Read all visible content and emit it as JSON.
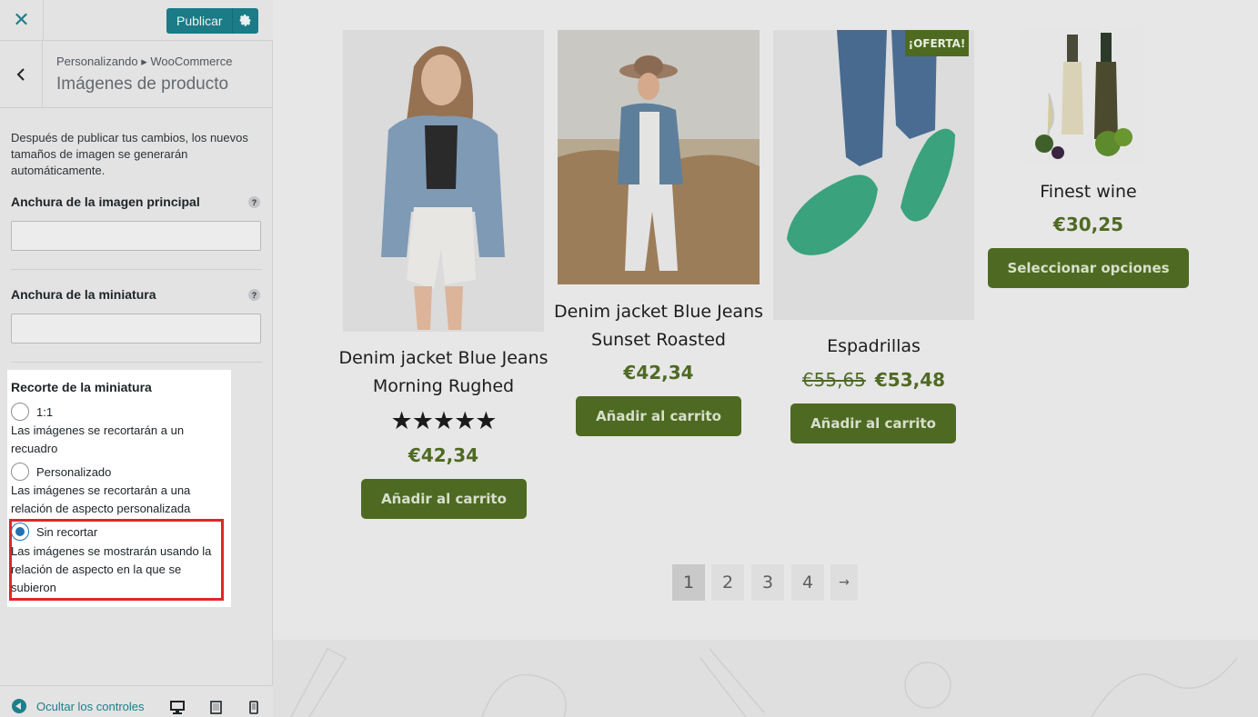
{
  "customizer": {
    "close_icon": "close-icon",
    "publish_label": "Publicar",
    "breadcrumb": "Personalizando ▸ WooCommerce",
    "section_title": "Imágenes de producto",
    "description": "Después de publicar tus cambios, los nuevos tamaños de imagen se generarán automáticamente.",
    "main_image_width_label": "Anchura de la imagen principal",
    "main_image_width_value": "",
    "thumbnail_width_label": "Anchura de la miniatura",
    "thumbnail_width_value": "",
    "help_glyph": "?",
    "crop": {
      "title": "Recorte de la miniatura",
      "options": [
        {
          "label": "1:1",
          "description": "Las imágenes se recortarán a un recuadro",
          "checked": false
        },
        {
          "label": "Personalizado",
          "description": "Las imágenes se recortarán a una relación de aspecto personalizada",
          "checked": false
        },
        {
          "label": "Sin recortar",
          "description": "Las imágenes se mostrarán usando la relación de aspecto en la que se subieron",
          "checked": true
        }
      ]
    },
    "footer": {
      "hide_controls": "Ocultar los controles",
      "devices": [
        "desktop-icon",
        "tablet-icon",
        "mobile-icon"
      ]
    }
  },
  "preview": {
    "products": [
      {
        "name": "Denim jacket Blue Jeans Morning Rughed",
        "rating_stars": "★★★★★",
        "rating": 5,
        "price": "€42,34",
        "button": "Añadir al carrito"
      },
      {
        "name": "Denim jacket Blue Jeans Sunset Roasted",
        "price": "€42,34",
        "button": "Añadir al carrito"
      },
      {
        "name": "Espadrillas",
        "badge": "¡OFERTA!",
        "old_price": "€55,65",
        "price": "€53,48",
        "button": "Añadir al carrito"
      },
      {
        "name": "Finest wine",
        "price": "€30,25",
        "button": "Seleccionar opciones"
      }
    ],
    "pagination": {
      "pages": [
        "1",
        "2",
        "3",
        "4"
      ],
      "current": "1",
      "next": "→"
    }
  },
  "colors": {
    "accent": "#1b7b86",
    "brand_green": "#4e6a22",
    "radio_checked": "#2271b1",
    "highlight": "#e02626"
  }
}
